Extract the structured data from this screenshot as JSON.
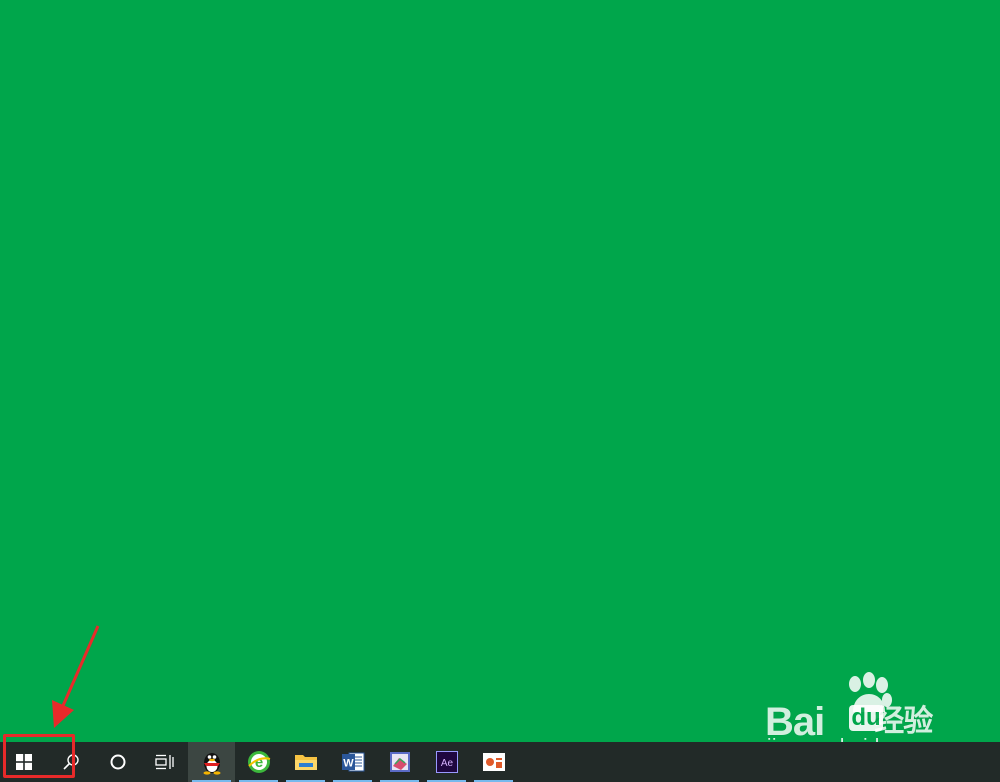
{
  "desktop": {
    "background_color": "#00a64b"
  },
  "taskbar": {
    "background_color": "#222a28",
    "items": [
      {
        "name": "start",
        "icon": "windows-logo-icon"
      },
      {
        "name": "search",
        "icon": "search-icon"
      },
      {
        "name": "cortana",
        "icon": "cortana-circle-icon"
      },
      {
        "name": "task-view",
        "icon": "task-view-icon"
      },
      {
        "name": "qq",
        "icon": "qq-penguin-icon",
        "label": "QQ"
      },
      {
        "name": "360-browser",
        "icon": "browser-e-icon",
        "label": "e"
      },
      {
        "name": "file-explorer",
        "icon": "folder-icon"
      },
      {
        "name": "word",
        "icon": "word-icon",
        "label": "W"
      },
      {
        "name": "book-app",
        "icon": "book-icon"
      },
      {
        "name": "after-effects",
        "icon": "after-effects-icon",
        "label": "Ae"
      },
      {
        "name": "powerpoint",
        "icon": "presentation-icon"
      }
    ]
  },
  "annotation": {
    "color": "#e82a2a"
  },
  "watermark": {
    "logo_latin_1": "Bai",
    "logo_latin_2": "du",
    "logo_cn": "经验",
    "url": "jingyan.baidu.com"
  }
}
